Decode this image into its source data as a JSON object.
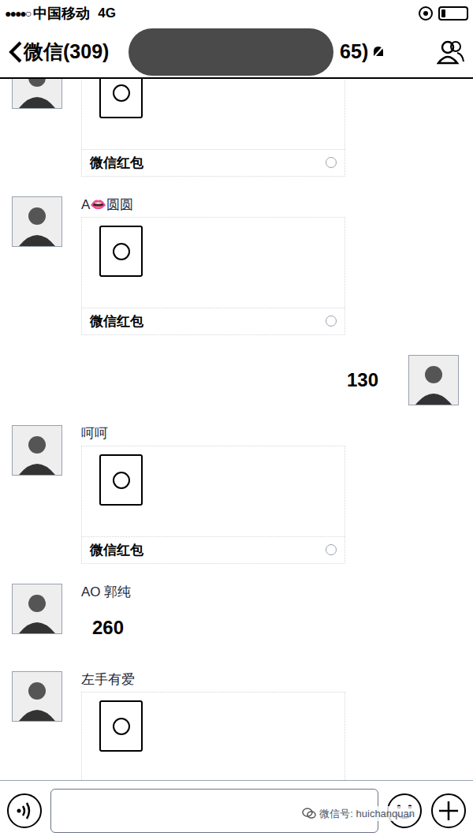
{
  "status_bar": {
    "signal": "●●●●○",
    "carrier": "中国移动",
    "network": "4G",
    "battery_level": 0.15
  },
  "nav": {
    "back": "微信(309)",
    "title": "65)",
    "muted": true
  },
  "messages": [
    {
      "kind": "red_packet",
      "sender": "",
      "outgoing": false,
      "label": "微信红包"
    },
    {
      "kind": "red_packet",
      "sender": "A👄圆圆",
      "outgoing": false,
      "label": "微信红包"
    },
    {
      "kind": "text",
      "sender": "",
      "outgoing": true,
      "text": "130"
    },
    {
      "kind": "red_packet",
      "sender": "呵呵",
      "outgoing": false,
      "label": "微信红包"
    },
    {
      "kind": "text",
      "sender": "AO 郭纯",
      "outgoing": false,
      "text": "260"
    },
    {
      "kind": "red_packet",
      "sender": "左手有爱",
      "outgoing": false
    }
  ],
  "watermark": "微信号: huichanquan"
}
